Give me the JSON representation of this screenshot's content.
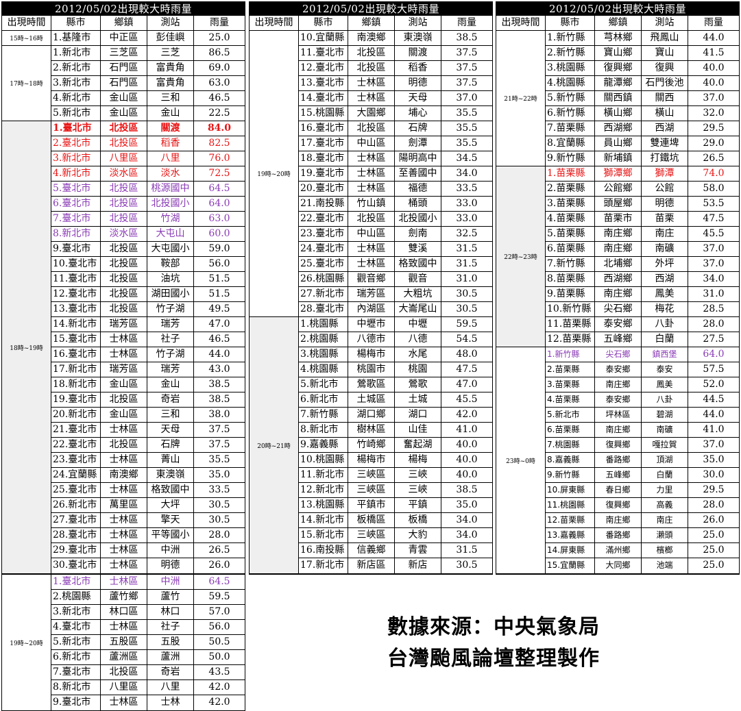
{
  "panels": [
    {
      "title": "2012/05/02出現較大時雨量",
      "groups": [
        {
          "time": "15時~16時",
          "shade": false,
          "rows": [
            [
              "1.基隆市",
              "中正區",
              "彭佳嶼",
              "25.0"
            ]
          ]
        },
        {
          "time": "17時~18時",
          "shade": false,
          "rows": [
            [
              "1.新北市",
              "三芝區",
              "三芝",
              "86.5"
            ],
            [
              "2.新北市",
              "石門區",
              "富貴角",
              "69.0"
            ],
            [
              "3.新北市",
              "石門區",
              "富貴角",
              "63.0"
            ],
            [
              "4.新北市",
              "金山區",
              "三和",
              "46.5"
            ],
            [
              "5.新北市",
              "金山區",
              "金山",
              "22.5"
            ]
          ]
        },
        {
          "time": "18時~19時",
          "shade": true,
          "rows": [
            [
              "1.臺北市",
              "北投區",
              "關渡",
              "84.0"
            ],
            [
              "2.臺北市",
              "北投區",
              "稻香",
              "82.5"
            ],
            [
              "3.新北市",
              "八里區",
              "八里",
              "76.0"
            ],
            [
              "4.新北市",
              "淡水區",
              "淡水",
              "72.5"
            ],
            [
              "5.臺北市",
              "北投區",
              "桃源國中",
              "64.5"
            ],
            [
              "6.臺北市",
              "北投區",
              "北投國小",
              "64.0"
            ],
            [
              "7.臺北市",
              "北投區",
              "竹湖",
              "63.0"
            ],
            [
              "8.新北市",
              "淡水區",
              "大屯山",
              "60.0"
            ],
            [
              "9.臺北市",
              "北投區",
              "大屯國小",
              "59.0"
            ],
            [
              "10.臺北市",
              "北投區",
              "鞍部",
              "56.0"
            ],
            [
              "11.臺北市",
              "北投區",
              "油坑",
              "51.5"
            ],
            [
              "12.臺北市",
              "北投區",
              "湖田國小",
              "51.5"
            ],
            [
              "13.臺北市",
              "北投區",
              "竹子湖",
              "49.5"
            ],
            [
              "14.新北市",
              "瑞芳區",
              "瑞芳",
              "47.0"
            ],
            [
              "15.臺北市",
              "士林區",
              "社子",
              "46.5"
            ],
            [
              "16.臺北市",
              "士林區",
              "竹子湖",
              "44.0"
            ],
            [
              "17.新北市",
              "瑞芳區",
              "瑞芳",
              "43.0"
            ],
            [
              "18.新北市",
              "金山區",
              "金山",
              "38.5"
            ],
            [
              "19.臺北市",
              "北投區",
              "奇岩",
              "38.5"
            ],
            [
              "20.新北市",
              "金山區",
              "三和",
              "38.0"
            ],
            [
              "21.臺北市",
              "士林區",
              "天母",
              "37.5"
            ],
            [
              "22.臺北市",
              "北投區",
              "石牌",
              "37.5"
            ],
            [
              "23.臺北市",
              "士林區",
              "菁山",
              "35.5"
            ],
            [
              "24.宜蘭縣",
              "南澳鄉",
              "東澳嶺",
              "35.0"
            ],
            [
              "25.臺北市",
              "士林區",
              "格致國中",
              "33.5"
            ],
            [
              "26.新北市",
              "萬里區",
              "大坪",
              "30.5"
            ],
            [
              "27.臺北市",
              "士林區",
              "擎天",
              "30.5"
            ],
            [
              "28.臺北市",
              "士林區",
              "平等國小",
              "28.0"
            ],
            [
              "29.臺北市",
              "士林區",
              "中洲",
              "26.5"
            ],
            [
              "30.臺北市",
              "士林區",
              "明德",
              "26.0"
            ]
          ]
        }
      ]
    },
    {
      "title": "2012/05/02出現較大時雨量",
      "groups": [
        {
          "time": "19時~20時",
          "shade": false,
          "rows": [
            [
              "10.宜蘭縣",
              "南澳鄉",
              "東澳嶺",
              "38.5"
            ],
            [
              "11.臺北市",
              "北投區",
              "關渡",
              "37.5"
            ],
            [
              "12.臺北市",
              "北投區",
              "稻香",
              "37.5"
            ],
            [
              "13.臺北市",
              "士林區",
              "明德",
              "37.5"
            ],
            [
              "14.臺北市",
              "士林區",
              "天母",
              "37.0"
            ],
            [
              "15.桃園縣",
              "大園鄉",
              "埔心",
              "35.5"
            ],
            [
              "16.臺北市",
              "北投區",
              "石牌",
              "35.5"
            ],
            [
              "17.臺北市",
              "中山區",
              "劍潭",
              "35.5"
            ],
            [
              "18.臺北市",
              "士林區",
              "陽明高中",
              "34.5"
            ],
            [
              "19.臺北市",
              "士林區",
              "至善國中",
              "34.0"
            ],
            [
              "20.臺北市",
              "士林區",
              "福德",
              "33.5"
            ],
            [
              "21.南投縣",
              "竹山鎮",
              "桶頭",
              "33.0"
            ],
            [
              "22.臺北市",
              "北投區",
              "北投國小",
              "33.0"
            ],
            [
              "23.臺北市",
              "中山區",
              "劍南",
              "32.5"
            ],
            [
              "24.臺北市",
              "士林區",
              "雙溪",
              "31.5"
            ],
            [
              "25.臺北市",
              "士林區",
              "格致國中",
              "31.5"
            ],
            [
              "26.桃園縣",
              "觀音鄉",
              "觀音",
              "31.0"
            ],
            [
              "27.新北市",
              "瑞芳區",
              "大粗坑",
              "30.5"
            ],
            [
              "28.臺北市",
              "內湖區",
              "大崙尾山",
              "30.5"
            ]
          ]
        },
        {
          "time": "20時~21時",
          "shade": true,
          "rows": [
            [
              "1.桃園縣",
              "中壢市",
              "中壢",
              "59.5"
            ],
            [
              "2.桃園縣",
              "八德市",
              "八德",
              "54.5"
            ],
            [
              "3.桃園縣",
              "楊梅市",
              "水尾",
              "48.0"
            ],
            [
              "4.桃園縣",
              "桃園市",
              "桃園",
              "47.5"
            ],
            [
              "5.新北市",
              "鶯歌區",
              "鶯歌",
              "47.0"
            ],
            [
              "6.新北市",
              "土城區",
              "土城",
              "45.5"
            ],
            [
              "7.新竹縣",
              "湖口鄉",
              "湖口",
              "42.0"
            ],
            [
              "8.新北市",
              "樹林區",
              "山佳",
              "41.0"
            ],
            [
              "9.嘉義縣",
              "竹崎鄉",
              "奮起湖",
              "40.0"
            ],
            [
              "10.桃園縣",
              "楊梅市",
              "楊梅",
              "40.0"
            ],
            [
              "11.新北市",
              "三峽區",
              "三峽",
              "40.0"
            ],
            [
              "12.新北市",
              "三峽區",
              "三峽",
              "38.5"
            ],
            [
              "13.桃園縣",
              "平鎮市",
              "平鎮",
              "35.0"
            ],
            [
              "14.新北市",
              "板橋區",
              "板橋",
              "34.0"
            ],
            [
              "15.新北市",
              "三峽區",
              "大豹",
              "34.0"
            ],
            [
              "16.南投縣",
              "信義鄉",
              "青雲",
              "31.5"
            ],
            [
              "17.新北市",
              "新店區",
              "新店",
              "30.5"
            ]
          ]
        }
      ]
    },
    {
      "title": "2012/05/02出現較大時雨量",
      "groups": [
        {
          "time": "21時~22時",
          "shade": false,
          "rows": [
            [
              "1.新竹縣",
              "芎林鄉",
              "飛鳳山",
              "44.0"
            ],
            [
              "2.新竹縣",
              "寶山鄉",
              "寶山",
              "41.5"
            ],
            [
              "3.桃園縣",
              "復興鄉",
              "復興",
              "40.0"
            ],
            [
              "4.桃園縣",
              "龍潭鄉",
              "石門後池",
              "40.0"
            ],
            [
              "5.新竹縣",
              "關西鎮",
              "關西",
              "37.0"
            ],
            [
              "6.新竹縣",
              "橫山鄉",
              "橫山",
              "32.0"
            ],
            [
              "7.苗栗縣",
              "西湖鄉",
              "西湖",
              "29.5"
            ],
            [
              "8.宜蘭縣",
              "員山鄉",
              "雙連埤",
              "29.0"
            ],
            [
              "9.新竹縣",
              "新埔鎮",
              "打鐵坑",
              "26.5"
            ]
          ]
        },
        {
          "time": "22時~23時",
          "shade": true,
          "rows": [
            [
              "1.苗栗縣",
              "獅潭鄉",
              "獅潭",
              "74.0"
            ],
            [
              "2.苗栗縣",
              "公館鄉",
              "公館",
              "58.0"
            ],
            [
              "3.苗栗縣",
              "頭屋鄉",
              "明德",
              "53.5"
            ],
            [
              "4.苗栗縣",
              "苗栗市",
              "苗栗",
              "47.5"
            ],
            [
              "5.苗栗縣",
              "南庄鄉",
              "南庄",
              "45.5"
            ],
            [
              "6.苗栗縣",
              "南庄鄉",
              "南礦",
              "37.0"
            ],
            [
              "7.新竹縣",
              "北埔鄉",
              "外坪",
              "37.0"
            ],
            [
              "8.苗栗縣",
              "西湖鄉",
              "西湖",
              "34.0"
            ],
            [
              "9.苗栗縣",
              "南庄鄉",
              "鳳美",
              "31.0"
            ],
            [
              "10.新竹縣",
              "尖石鄉",
              "梅花",
              "28.5"
            ],
            [
              "11.苗栗縣",
              "泰安鄉",
              "八卦",
              "28.0"
            ],
            [
              "12.苗栗縣",
              "五峰鄉",
              "白蘭",
              "27.5"
            ]
          ]
        },
        {
          "time": "23時~0時",
          "shade": false,
          "rows": [
            [
              "1.新竹縣",
              "尖石鄉",
              "鎮西堡",
              "64.0"
            ],
            [
              "2.苗栗縣",
              "泰安鄉",
              "泰安",
              "57.5"
            ],
            [
              "3.苗栗縣",
              "南庄鄉",
              "鳳美",
              "52.0"
            ],
            [
              "4.苗栗縣",
              "泰安鄉",
              "八卦",
              "44.5"
            ],
            [
              "5.新北市",
              "坪林區",
              "碧湖",
              "44.0"
            ],
            [
              "6.苗栗縣",
              "南庄鄉",
              "南礦",
              "41.0"
            ],
            [
              "7.桃園縣",
              "復興鄉",
              "嘎拉賀",
              "37.0"
            ],
            [
              "8.嘉義縣",
              "番路鄉",
              "頂湖",
              "35.0"
            ],
            [
              "9.新竹縣",
              "五峰鄉",
              "白蘭",
              "30.0"
            ],
            [
              "10.屏東縣",
              "春日鄉",
              "力里",
              "29.5"
            ],
            [
              "11.桃園縣",
              "復興鄉",
              "高義",
              "28.0"
            ],
            [
              "12.苗栗縣",
              "南庄鄉",
              "南庄",
              "26.0"
            ],
            [
              "13.嘉義縣",
              "番路鄉",
              "瀨頭",
              "25.0"
            ],
            [
              "14.屏東縣",
              "滿州鄉",
              "檳榔",
              "25.0"
            ],
            [
              "15.宜蘭縣",
              "大同鄉",
              "池端",
              "25.0"
            ]
          ]
        }
      ]
    }
  ],
  "header": [
    "出現時間",
    "縣市",
    "鄉鎮",
    "測站",
    "雨量"
  ],
  "extra": {
    "time": "19時~20時",
    "rows": [
      [
        "1.臺北市",
        "士林區",
        "中洲",
        "64.5"
      ],
      [
        "2.桃園縣",
        "蘆竹鄉",
        "蘆竹",
        "59.5"
      ],
      [
        "3.新北市",
        "林口區",
        "林口",
        "57.0"
      ],
      [
        "4.臺北市",
        "士林區",
        "社子",
        "56.0"
      ],
      [
        "5.新北市",
        "五股區",
        "五股",
        "50.5"
      ],
      [
        "6.新北市",
        "蘆洲區",
        "蘆洲",
        "50.0"
      ],
      [
        "7.臺北市",
        "北投區",
        "奇岩",
        "43.5"
      ],
      [
        "8.新北市",
        "八里區",
        "八里",
        "42.0"
      ],
      [
        "9.臺北市",
        "士林區",
        "士林",
        "42.0"
      ]
    ]
  },
  "credit": {
    "line1": "數據來源：中央氣象局",
    "line2": "台灣颱風論壇整理製作"
  },
  "colors": {
    "red": "#e81414",
    "purple": "#8a3bb5",
    "shade": "#efefef"
  },
  "highlight": {
    "p0g2": [
      "redb",
      "red",
      "red",
      "red",
      "purple",
      "purple",
      "purple",
      "purple"
    ],
    "p1g0": [],
    "p2g1": [
      "red"
    ],
    "p2g2": [
      "purple small"
    ],
    "extra": [
      "purple"
    ]
  }
}
